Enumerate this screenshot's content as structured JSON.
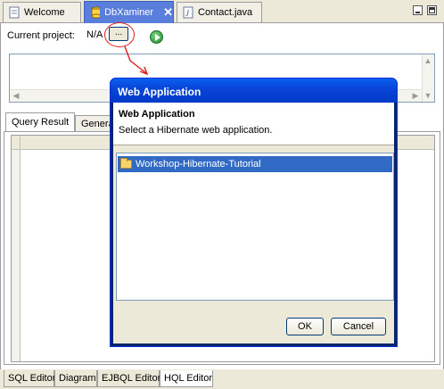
{
  "editor_tabs": [
    {
      "label": "Welcome"
    },
    {
      "label": "DbXaminer",
      "close": "✕"
    },
    {
      "label": "Contact.java"
    }
  ],
  "project": {
    "label": "Current project:",
    "value": "N/A",
    "browse_label": "..."
  },
  "result_tabs": [
    {
      "label": "Query Result"
    },
    {
      "label": "Genera"
    }
  ],
  "bottom_tabs": [
    {
      "label": "SQL Editor"
    },
    {
      "label": "Diagram"
    },
    {
      "label": "EJBQL Editor"
    },
    {
      "label": "HQL Editor"
    }
  ],
  "dialog": {
    "title": "Web Application",
    "heading": "Web Application",
    "subtitle": "Select a Hibernate web application.",
    "items": [
      {
        "label": "Workshop-Hibernate-Tutorial"
      }
    ],
    "ok_label": "OK",
    "cancel_label": "Cancel"
  },
  "colors": {
    "highlight": "#e01a1a",
    "selection": "#316ac5",
    "title_bar": "#0845d8"
  },
  "icons": {
    "welcome_tab": "page-icon",
    "dbxaminer_tab": "database-icon",
    "contact_tab": "java-file-icon",
    "run": "run-icon",
    "list_item": "folder-icon"
  }
}
